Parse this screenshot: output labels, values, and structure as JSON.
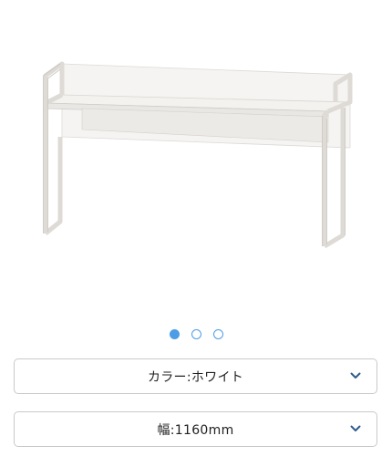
{
  "carousel": {
    "image_icon": "furniture-shelf-image",
    "active_index": 0,
    "dots": [
      {
        "active": true
      },
      {
        "active": false
      },
      {
        "active": false
      }
    ],
    "accent_color": "#4d9de6"
  },
  "options": {
    "color_select": {
      "label": "カラー:ホワイト",
      "icon": "chevron-down-icon"
    },
    "width_select": {
      "label": "幅:1160mm",
      "icon": "chevron-down-icon"
    }
  }
}
